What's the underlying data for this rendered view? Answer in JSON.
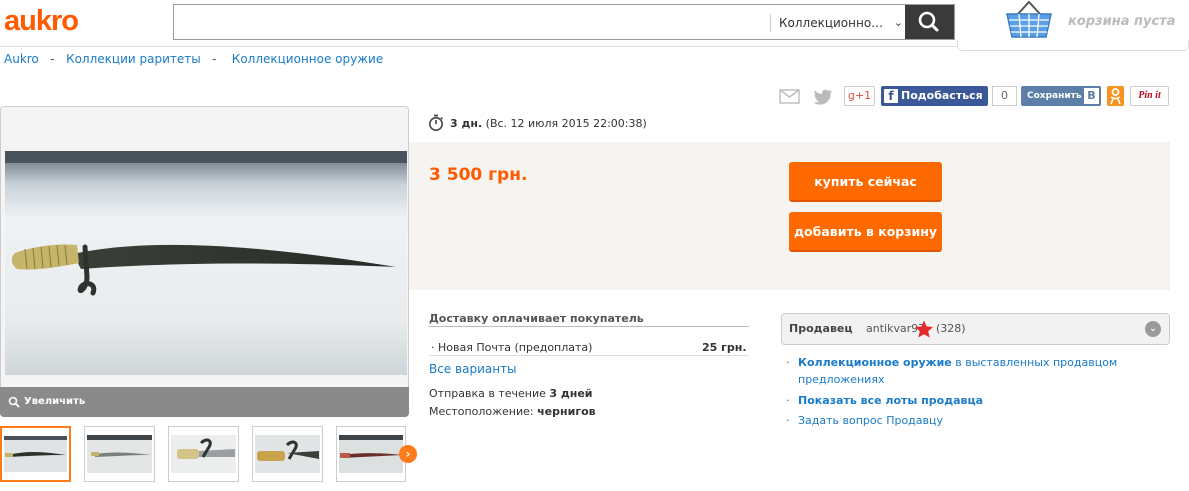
{
  "header": {
    "logo": "aukro",
    "search_value": "",
    "search_category": "Коллекционно…",
    "cart_text": "корзина пуста"
  },
  "breadcrumb": [
    "Aukro",
    "Коллекции раритеты",
    "Коллекционное оружие"
  ],
  "breadcrumb_sep": "-",
  "share": {
    "facebook_label": "Подобасться",
    "facebook_count": "0",
    "vk_label": "Сохранить",
    "vk_letter": "В",
    "pinterest_label": "Pin it",
    "gplus_label": "g+1"
  },
  "timer": {
    "remaining": "3 дн.",
    "end": "(Вс. 12 июля 2015 22:00:38)"
  },
  "offer": {
    "price": "3 500 грн.",
    "buy_now": "купить сейчас",
    "add_to_cart": "добавить в корзину"
  },
  "gallery": {
    "zoom_label": "Увеличить",
    "thumb_count": 5
  },
  "delivery": {
    "title": "Доставку оплачивает покупатель",
    "option_name": "Новая Почта (предоплата)",
    "option_price": "25 грн.",
    "all_options": "Все варианты",
    "ship_prefix": "Отправка в течение ",
    "ship_value": "3 дней",
    "loc_prefix": "Местоположение: ",
    "loc_value": "чернигов"
  },
  "seller": {
    "label": "Продавец",
    "name": "antikvar97",
    "rating": "(328)",
    "link1_bold": "Коллекционное оружие",
    "link1_rest": " в выставленных продавцом предложениях",
    "link2": "Показать все лоты продавца",
    "link3": "Задать вопрос Продавцу"
  },
  "colors": {
    "brand": "#ff5a00",
    "link": "#1a7bc8",
    "button": "#ff6a00"
  }
}
